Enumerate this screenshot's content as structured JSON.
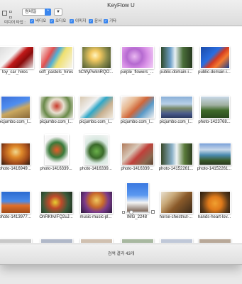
{
  "window": {
    "title": "KeyFlow U"
  },
  "toolbar": {
    "layout_label": "ㅁㅁ",
    "select_value": "썸네일",
    "sort_glyph": "▼"
  },
  "filters": {
    "label": "미디어 타입 :",
    "items": [
      {
        "label": "비디오",
        "checked": true
      },
      {
        "label": "오디오",
        "checked": true
      },
      {
        "label": "이미지",
        "checked": true
      },
      {
        "label": "문서",
        "checked": true
      },
      {
        "label": "기타",
        "checked": true
      }
    ]
  },
  "grid": {
    "rows": [
      [
        "toy_car_hires",
        "soft_pastels_hires",
        "fiChfyPwknRQO...",
        "purple_flowers_...",
        "public-domain-i...",
        "public-domain-i..."
      ],
      [
        "picjumbo.com_l...",
        "picjumbo.com_l...",
        "picjumbo.com_l...",
        "picjumbo.com_l...",
        "picjumbo.com_l...",
        "photo-1423768..."
      ],
      [
        "photo-1416949...",
        "photo-1416339...",
        "photo-1416339...",
        "photo-1416339...",
        "photo-14152261...",
        "photo-14152261..."
      ],
      [
        "photo-1413977...",
        "OnRKhvIFQ2uJ...",
        "music-music-pl...",
        "IMG_2248",
        "horse-chestnut-...",
        "hands-heart-lov..."
      ]
    ],
    "row5_partial": [
      "",
      "",
      "",
      "",
      "",
      ""
    ]
  },
  "status": {
    "text": "검색 결과 43개"
  }
}
